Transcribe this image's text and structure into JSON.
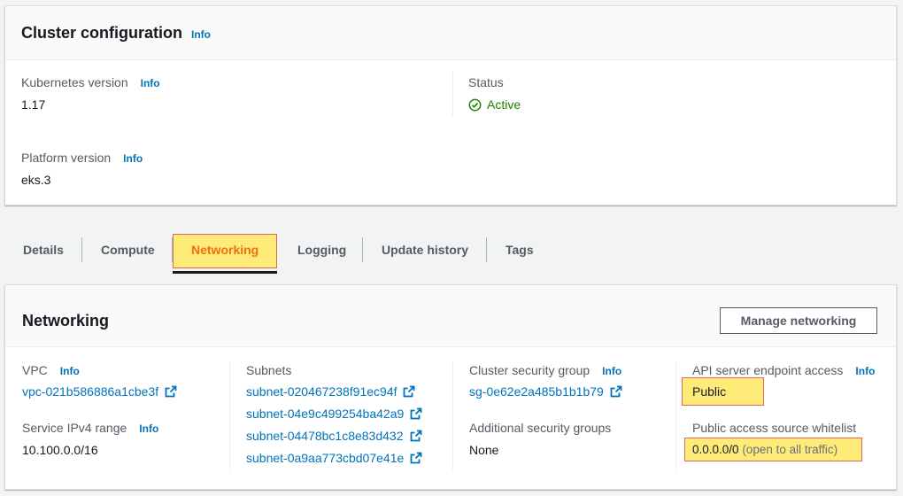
{
  "cluster_config": {
    "title": "Cluster configuration",
    "info": "Info",
    "kubernetes_version": {
      "label": "Kubernetes version",
      "info": "Info",
      "value": "1.17"
    },
    "platform_version": {
      "label": "Platform version",
      "info": "Info",
      "value": "eks.3"
    },
    "status": {
      "label": "Status",
      "value": "Active",
      "icon": "check-circle-icon",
      "color": "#1d8102"
    }
  },
  "tabs": [
    {
      "label": "Details"
    },
    {
      "label": "Compute"
    },
    {
      "label": "Networking",
      "selected": true
    },
    {
      "label": "Logging"
    },
    {
      "label": "Update history"
    },
    {
      "label": "Tags"
    }
  ],
  "networking": {
    "title": "Networking",
    "manage_button": "Manage networking",
    "vpc": {
      "label": "VPC",
      "info": "Info",
      "value": "vpc-021b586886a1cbe3f"
    },
    "service_ipv4": {
      "label": "Service IPv4 range",
      "info": "Info",
      "value": "10.100.0.0/16"
    },
    "subnets": {
      "label": "Subnets",
      "values": [
        "subnet-020467238f91ec94f",
        "subnet-04e9c499254ba42a9",
        "subnet-04478bc1c8e83d432",
        "subnet-0a9aa773cbd07e41e"
      ]
    },
    "cluster_sg": {
      "label": "Cluster security group",
      "info": "Info",
      "value": "sg-0e62e2a485b1b1b79"
    },
    "additional_sg": {
      "label": "Additional security groups",
      "value": "None"
    },
    "api_access": {
      "label": "API server endpoint access",
      "info": "Info",
      "value": "Public"
    },
    "whitelist": {
      "label": "Public access source whitelist",
      "value": "0.0.0.0/0",
      "note": "(open to all traffic)"
    }
  },
  "colors": {
    "link": "#0073bb",
    "highlight": "#ffeb78",
    "highlight_border": "#e0655c"
  }
}
